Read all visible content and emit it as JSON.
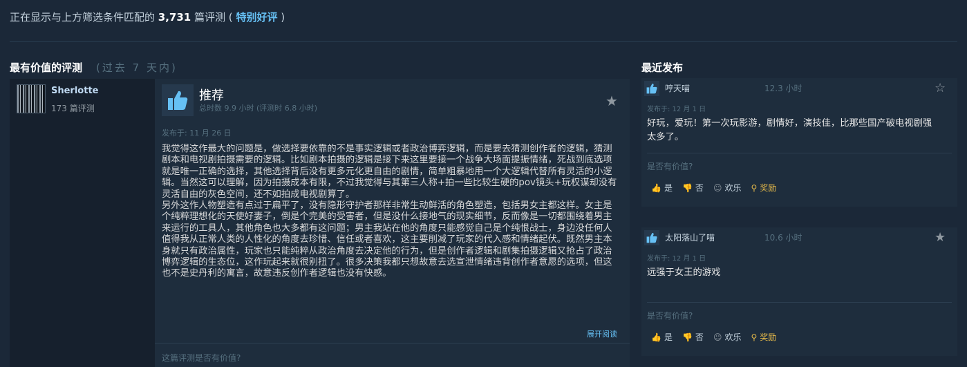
{
  "summary": {
    "prefix": "正在显示与上方筛选条件匹配的",
    "count": "3,731",
    "suffix": "篇评测 (",
    "rating": "特别好评",
    "close": ")"
  },
  "left_section": {
    "title": "最有价值的评测",
    "subtitle": "(过去 7 天内)"
  },
  "right_section": {
    "title": "最近发布"
  },
  "main_review": {
    "author": "Sherlotte",
    "author_reviews": "173 篇评测",
    "recommendation": "推荐",
    "hours": "总时数 9.9 小时 (评测时 6.8 小时)",
    "posted": "发布于: 11 月 26 日",
    "paragraphs": [
      "我觉得这作最大的问题是，做选择要依靠的不是事实逻辑或者政治博弈逻辑，而是要去猜测创作者的逻辑，猜测剧本和电视剧拍摄需要的逻辑。比如剧本拍摄的逻辑是接下来这里要接一个战争大场面提振情绪，死战到底选项就是唯一正确的选择，其他选择背后没有更多元化更自由的剧情，简单粗暴地用一个大逻辑代替所有灵活的小逻辑。当然这可以理解，因为拍摄成本有限，不过我觉得与其第三人称+拍一些比较生硬的pov镜头+玩权谋却没有灵活自由的灰色空间，还不如拍成电视剧算了。",
      "另外这作人物塑造有点过于扁平了，没有隐形守护者那样非常生动鲜活的角色塑造，包括男女主都这样。女主是个纯粹理想化的天使好妻子，倒是个完美的受害者，但是没什么接地气的现实细节，反而像是一切都围绕着男主来运行的工具人，其他角色也大多都有这问题；男主我站在他的角度只能感觉自己是个纯恨战士，身边没任何人值得我从正常人类的人性化的角度去珍惜、信任或者喜欢，这主要削减了玩家的代入感和情绪起伏。既然男主本身就只有政治属性，玩家也只能纯粹从政治角度去决定他的行为，但是创作者逻辑和剧集拍摄逻辑又抢占了政治博弈逻辑的生态位，这作玩起来就很别扭了。很多决策我都只想故意去选宣泄情绪违背创作者意愿的选项，但这也不是史丹利的寓言，故意违反创作者逻辑也没有快感。"
    ],
    "expand": "展开阅读",
    "helpful_question": "这篇评测是否有价值?"
  },
  "recent_reviews": [
    {
      "author": "哼天喵",
      "hours": "12.3 小时",
      "posted": "发布于: 12 月 1 日",
      "text": "好玩，爱玩！第一次玩影游，剧情好，演技佳，比那些国产破电视剧强太多了。",
      "helpful_question": "是否有价值?",
      "buttons": {
        "yes": "是",
        "no": "否",
        "funny": "欢乐",
        "award": "奖励"
      }
    },
    {
      "author": "太阳落山了喵",
      "hours": "10.6 小时",
      "posted": "发布于: 12 月 1 日",
      "text": "远强于女王的游戏",
      "helpful_question": "是否有价值?",
      "buttons": {
        "yes": "是",
        "no": "否",
        "funny": "欢乐",
        "award": "奖励"
      }
    }
  ],
  "colors": {
    "background": "#1b2838",
    "panel": "#1e2d3d",
    "accent": "#66c0f4",
    "award": "#e3b84a"
  }
}
